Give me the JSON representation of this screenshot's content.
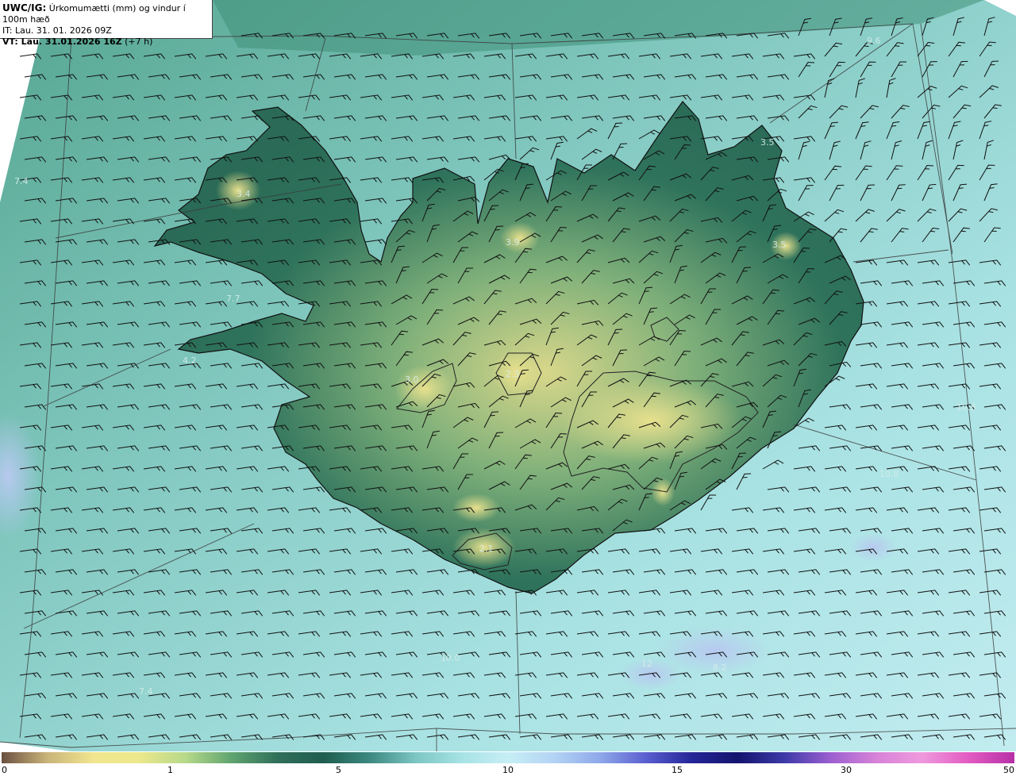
{
  "info": {
    "model": "UWC/IG:",
    "title": "Úrkomumætti (mm) og vindur í 100m hæð",
    "init_time": "IT: Lau. 31. 01. 2026 09Z",
    "valid_label": "VT: Lau. 31.01.2026 16Z",
    "lead": "(+7 h)"
  },
  "map_values": [
    "9.6",
    "7.4",
    "3.4",
    "3.5",
    "3.9",
    "3.5",
    "7.7",
    "4.2",
    "3.0",
    "2.3",
    "10.8",
    "10.8",
    "2.1",
    "10.0",
    "7.4",
    "12",
    "8.2"
  ],
  "legend": {
    "ticks": [
      "0",
      "1",
      "5",
      "10",
      "15",
      "30",
      "50"
    ],
    "colors": [
      "#6b5040",
      "#c9b47a",
      "#f1e68f",
      "#ece88b",
      "#b6d98a",
      "#5fa46f",
      "#2f6f5a",
      "#1f5d4f",
      "#3c8a82",
      "#7cc6c3",
      "#a7e3e6",
      "#c7eef5",
      "#b3d4f4",
      "#8fa8ea",
      "#5a5fcf",
      "#242596",
      "#14146e",
      "#3d3aa8",
      "#9b5fd0",
      "#d783d8",
      "#ef99dd",
      "#e25bc2",
      "#b62fa6"
    ]
  },
  "colors": {
    "land_low": "#2d6e5a",
    "land_high": "#dcd98c",
    "sea": "#8fd3cf",
    "sea_light": "#c6eef0",
    "coast": "#111111",
    "barb": "#111111"
  }
}
